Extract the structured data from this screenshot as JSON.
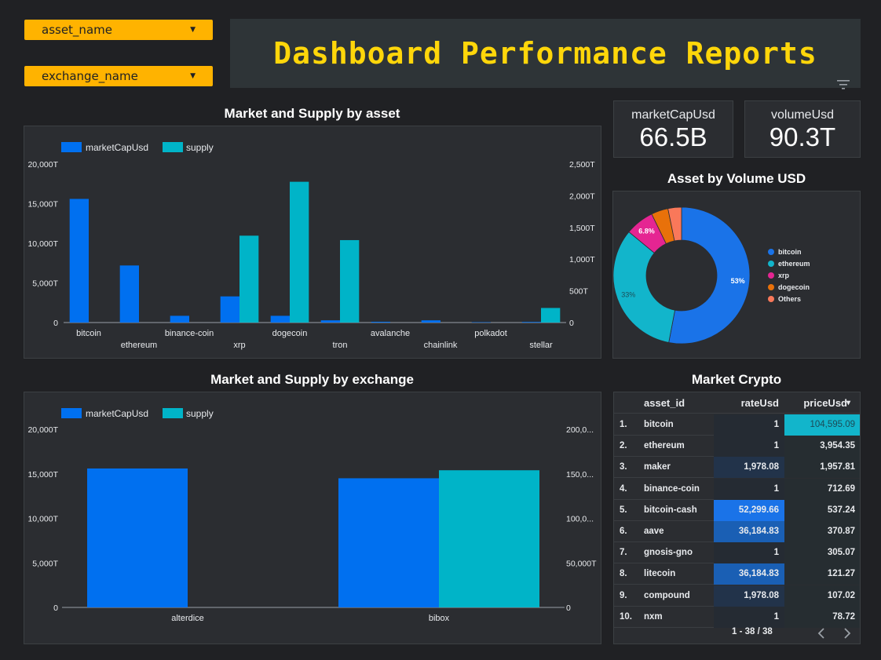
{
  "filters": {
    "asset_name": "asset_name",
    "exchange_name": "exchange_name"
  },
  "header": {
    "title": "Dashboard Performance Reports"
  },
  "kpis": [
    {
      "label": "marketCapUsd",
      "value": "66.5B"
    },
    {
      "label": "volumeUsd",
      "value": "90.3T"
    }
  ],
  "colors": {
    "marketCap": "#0070f0",
    "supply": "#00b4c8",
    "accent": "#ffb300",
    "title": "#ffd60a"
  },
  "chart_data": [
    {
      "type": "bar",
      "title": "Market and Supply by asset",
      "categories": [
        "bitcoin",
        "ethereum",
        "binance-coin",
        "xrp",
        "dogecoin",
        "tron",
        "avalanche",
        "chainlink",
        "polkadot",
        "stellar"
      ],
      "series": [
        {
          "name": "marketCapUsd",
          "axis": "left",
          "values": [
            15600,
            7200,
            850,
            3300,
            850,
            280,
            100,
            280,
            50,
            80
          ]
        },
        {
          "name": "supply",
          "axis": "right",
          "values": [
            0,
            0,
            0,
            1370,
            2220,
            1300,
            0,
            0,
            0,
            230
          ]
        }
      ],
      "left_ticks": [
        "20,000T",
        "15,000T",
        "10,000T",
        "5,000T",
        "0"
      ],
      "right_ticks": [
        "2,500T",
        "2,000T",
        "1,500T",
        "1,000T",
        "500T",
        "0"
      ],
      "ylim_left": [
        0,
        20000
      ],
      "ylim_right": [
        0,
        2500
      ],
      "legend": "top-left"
    },
    {
      "type": "bar",
      "title": "Market and Supply by exchange",
      "categories": [
        "alterdice",
        "bibox"
      ],
      "series": [
        {
          "name": "marketCapUsd",
          "axis": "left",
          "values": [
            15600,
            14500
          ]
        },
        {
          "name": "supply",
          "axis": "right",
          "values": [
            0,
            154000
          ]
        }
      ],
      "left_ticks": [
        "20,000T",
        "15,000T",
        "10,000T",
        "5,000T",
        "0"
      ],
      "right_ticks": [
        "200,0...",
        "150,0...",
        "100,0...",
        "50,000T",
        "0"
      ],
      "ylim_left": [
        0,
        20000
      ],
      "ylim_right": [
        0,
        200000
      ],
      "legend": "top-left"
    },
    {
      "type": "pie",
      "title": "Asset by Volume USD",
      "labels": [
        "bitcoin",
        "ethereum",
        "xrp",
        "dogecoin",
        "Others"
      ],
      "values": [
        53,
        33,
        6.8,
        4,
        3.2
      ],
      "slice_labels": [
        "53%",
        "33%",
        "6.8%",
        "",
        ""
      ],
      "colors": [
        "#1a73e8",
        "#12b5cb",
        "#e52592",
        "#e8710a",
        "#f9785a"
      ],
      "legend": "right"
    }
  ],
  "table": {
    "title": "Market Crypto",
    "headers": [
      "asset_id",
      "rateUsd",
      "priceUsd"
    ],
    "sort_indicator": "▾",
    "rows": [
      {
        "idx": "1.",
        "asset": "bitcoin",
        "rate": "1",
        "price": "104,595.09",
        "rate_level": 0,
        "price_level": 1
      },
      {
        "idx": "2.",
        "asset": "ethereum",
        "rate": "1",
        "price": "3,954.35",
        "rate_level": 0,
        "price_level": 0.05
      },
      {
        "idx": "3.",
        "asset": "maker",
        "rate": "1,978.08",
        "price": "1,957.81",
        "rate_level": 0.1,
        "price_level": 0.03
      },
      {
        "idx": "4.",
        "asset": "binance-coin",
        "rate": "1",
        "price": "712.69",
        "rate_level": 0,
        "price_level": 0.01
      },
      {
        "idx": "5.",
        "asset": "bitcoin-cash",
        "rate": "52,299.66",
        "price": "537.24",
        "rate_level": 1,
        "price_level": 0.01
      },
      {
        "idx": "6.",
        "asset": "aave",
        "rate": "36,184.83",
        "price": "370.87",
        "rate_level": 0.7,
        "price_level": 0
      },
      {
        "idx": "7.",
        "asset": "gnosis-gno",
        "rate": "1",
        "price": "305.07",
        "rate_level": 0,
        "price_level": 0
      },
      {
        "idx": "8.",
        "asset": "litecoin",
        "rate": "36,184.83",
        "price": "121.27",
        "rate_level": 0.7,
        "price_level": 0
      },
      {
        "idx": "9.",
        "asset": "compound",
        "rate": "1,978.08",
        "price": "107.02",
        "rate_level": 0.1,
        "price_level": 0
      },
      {
        "idx": "10.",
        "asset": "nxm",
        "rate": "1",
        "price": "78.72",
        "rate_level": 0,
        "price_level": 0
      }
    ],
    "pagination": "1 - 38 / 38"
  }
}
